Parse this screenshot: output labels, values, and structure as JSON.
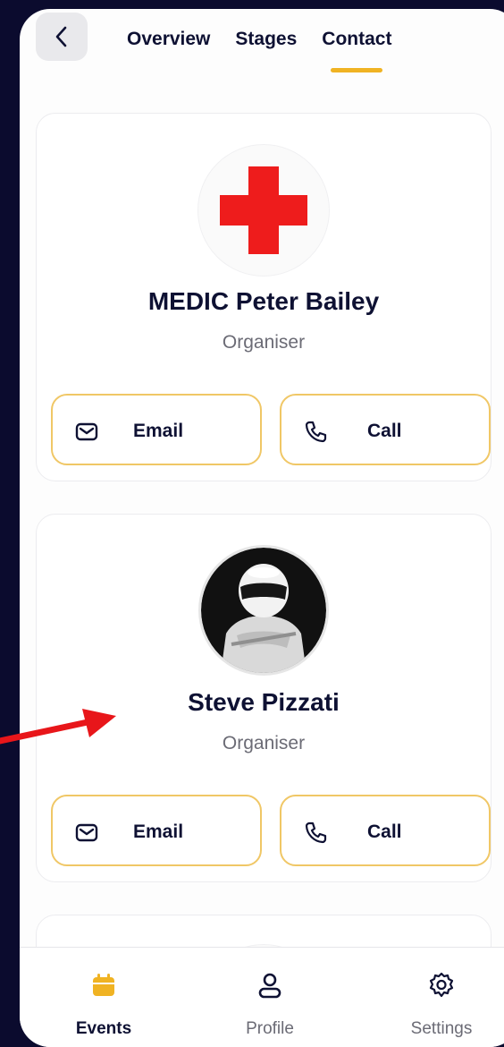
{
  "tabs": [
    {
      "label": "Overview",
      "active": false
    },
    {
      "label": "Stages",
      "active": false
    },
    {
      "label": "Contact",
      "active": true
    }
  ],
  "contacts": [
    {
      "name": "MEDIC Peter Bailey",
      "role": "Organiser",
      "email_label": "Email",
      "call_label": "Call",
      "avatar": "red-cross-icon"
    },
    {
      "name": "Steve Pizzati",
      "role": "Organiser",
      "email_label": "Email",
      "call_label": "Call",
      "avatar": "racing-driver-photo"
    }
  ],
  "bottom_nav": [
    {
      "label": "Events",
      "icon": "calendar-icon",
      "active": true
    },
    {
      "label": "Profile",
      "icon": "user-icon",
      "active": false
    },
    {
      "label": "Settings",
      "icon": "gear-icon",
      "active": false
    }
  ],
  "colors": {
    "accent": "#f0b323",
    "button_border": "#f0c766",
    "text_dark": "#0e1133",
    "text_muted": "#6b6b75",
    "outer_bg": "#0b0b2e",
    "medic_red": "#ee1c1c",
    "arrow_red": "#e8161a"
  }
}
